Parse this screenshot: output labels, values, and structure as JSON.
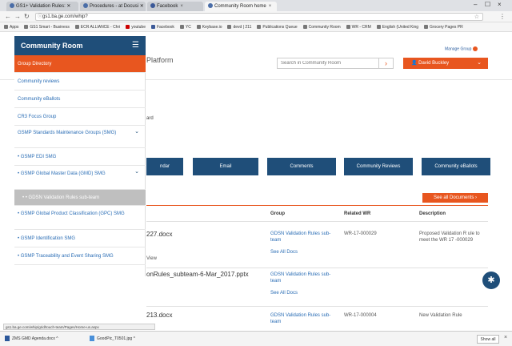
{
  "browser": {
    "tabs": [
      {
        "label": "GS1+ Validation Rules: ✕"
      },
      {
        "label": "Procedures - at Docusi ✕"
      },
      {
        "label": "Facebook"
      },
      {
        "label": "Community Room  home"
      }
    ],
    "url": "gs1.ba.ge.com/whip?",
    "bookmarks": [
      "Apps",
      "GS1 Smart - Business",
      "ECR ALLIANCE - Chri",
      "youtube",
      "Facebook",
      "YC",
      "Keybase.io",
      "devd | 211",
      "Publications Queue",
      "Community Room",
      "WR - CRM",
      "English (United King",
      "Grocery Pages PR"
    ]
  },
  "header": {
    "manage_group": "Manage Group",
    "platform_title": "Platform",
    "search_placeholder": "Search in Community Room",
    "user_name": "David Buckley",
    "ard_text": "ard"
  },
  "actions": [
    "ndar",
    "Email",
    "Comments",
    "Community Reviews",
    "Community eBallots"
  ],
  "documents": {
    "see_all": "See all Documents",
    "columns": {
      "group": "Group",
      "related_wr": "Related WR",
      "description": "Description"
    },
    "rows": [
      {
        "name": "227.docx",
        "view": "View",
        "group": "GDSN Validation Rules sub-team",
        "see_all": "See All Docs",
        "wr": "WR-17-000029",
        "desc": "Proposed Validation R ule to meet the WR 17 -000029"
      },
      {
        "name": "onRules_subteam-6-Mar_2017.pptx",
        "group": "GDSN Validation Rules sub-team",
        "see_all": "See All Docs",
        "wr": "",
        "desc": ""
      },
      {
        "name": "213.docx",
        "group": "GDSN Validation Rules sub-team",
        "wr": "WR-17-000004",
        "desc": "New Validation Rule"
      }
    ]
  },
  "sidebar": {
    "title": "Community Room",
    "items": [
      {
        "label": "Group Directory"
      },
      {
        "label": "Community reviews"
      },
      {
        "label": "Community eBallots"
      },
      {
        "label": "CR3 Focus Group"
      },
      {
        "label": "GSMP Standards Maintenance Groups (SMG)"
      },
      {
        "label": "• GSMP EDI SMG"
      },
      {
        "label": "• GSMP Global Master Data (GMD) SMG"
      },
      {
        "label": "• • GDSN Validation Rules sub-team"
      },
      {
        "label": "• GSMP Global Product Classification (GPC) SMG"
      },
      {
        "label": "• GSMP Identification SMG"
      },
      {
        "label": "• GSMP Traceability and Event Sharing SMG"
      }
    ]
  },
  "status": {
    "hover_url": "gs1.ba.ge.com/whip/grid/touch-team/Pages/Home-us.aspx",
    "downloads": [
      "ZMS GMD Agenda.docx",
      "GoodPic_T0501.jpg"
    ],
    "show_all": "Show all"
  },
  "colors": {
    "accent": "#e8561f",
    "navy": "#1f4e79",
    "link": "#2a6db5"
  }
}
